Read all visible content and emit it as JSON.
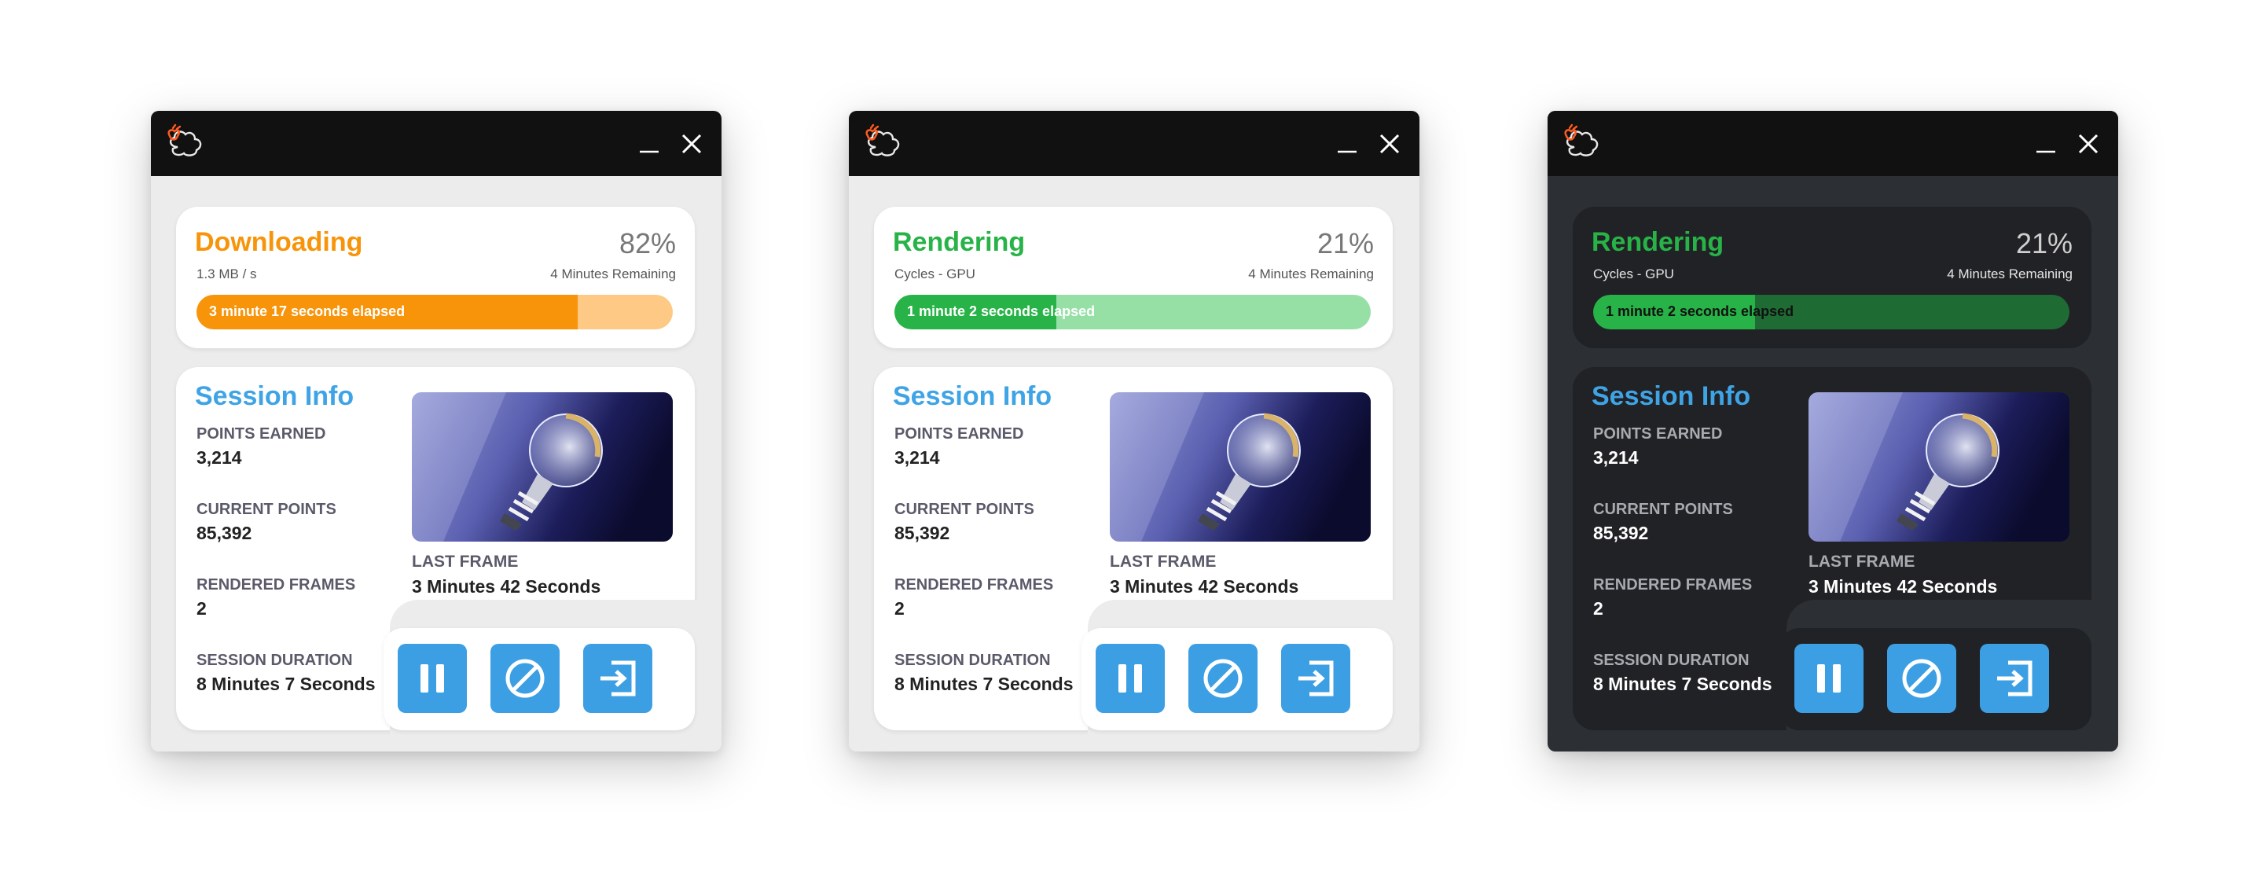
{
  "colors": {
    "accent_blue": "#3fa4e5",
    "button_blue": "#3d9fe3",
    "downloading_orange": "#f7940a",
    "downloading_track": "#fdc984",
    "rendering_green": "#27b347",
    "rendering_track": "#96e0a6",
    "rendering_track_dark": "#1e6b34",
    "titlebar": "#111111"
  },
  "windows": [
    {
      "theme": "light",
      "status": {
        "title": "Downloading",
        "percent": "82%",
        "subtitle": "1.3 MB / s",
        "remaining": "4 Minutes Remaining",
        "progress_fraction": 0.8,
        "elapsed": "3 minute 17 seconds elapsed",
        "color": "#f7940a",
        "track": "#fdc984"
      },
      "session": {
        "title": "Session Info",
        "stats": [
          {
            "label": "POINTS EARNED",
            "value": "3,214"
          },
          {
            "label": "CURRENT POINTS",
            "value": "85,392"
          },
          {
            "label": "RENDERED FRAMES",
            "value": "2"
          },
          {
            "label": "SESSION DURATION",
            "value": "8 Minutes 7 Seconds"
          }
        ],
        "last_frame_label": "LAST FRAME",
        "last_frame_value": "3 Minutes 42 Seconds"
      }
    },
    {
      "theme": "light",
      "status": {
        "title": "Rendering",
        "percent": "21%",
        "subtitle": "Cycles - GPU",
        "remaining": "4 Minutes Remaining",
        "progress_fraction": 0.34,
        "elapsed": "1 minute 2 seconds elapsed",
        "color": "#27b347",
        "track": "#96e0a6"
      },
      "session": {
        "title": "Session Info",
        "stats": [
          {
            "label": "POINTS EARNED",
            "value": "3,214"
          },
          {
            "label": "CURRENT POINTS",
            "value": "85,392"
          },
          {
            "label": "RENDERED FRAMES",
            "value": "2"
          },
          {
            "label": "SESSION DURATION",
            "value": "8 Minutes 7 Seconds"
          }
        ],
        "last_frame_label": "LAST FRAME",
        "last_frame_value": "3 Minutes 42 Seconds"
      }
    },
    {
      "theme": "dark",
      "status": {
        "title": "Rendering",
        "percent": "21%",
        "subtitle": "Cycles - GPU",
        "remaining": "4 Minutes Remaining",
        "progress_fraction": 0.34,
        "elapsed": "1 minute 2 seconds elapsed",
        "color": "#27b347",
        "track": "#1e6b34"
      },
      "session": {
        "title": "Session Info",
        "stats": [
          {
            "label": "POINTS EARNED",
            "value": "3,214"
          },
          {
            "label": "CURRENT POINTS",
            "value": "85,392"
          },
          {
            "label": "RENDERED FRAMES",
            "value": "2"
          },
          {
            "label": "SESSION DURATION",
            "value": "8 Minutes 7 Seconds"
          }
        ],
        "last_frame_label": "LAST FRAME",
        "last_frame_value": "3 Minutes 42 Seconds"
      }
    }
  ],
  "icons": {
    "logo": "sheep-logo-icon",
    "minimize": "minimize-icon",
    "close": "close-icon",
    "pause": "pause-icon",
    "stop": "block-icon",
    "exit": "exit-icon",
    "thumbnail": "lightbulb-render-thumbnail"
  }
}
